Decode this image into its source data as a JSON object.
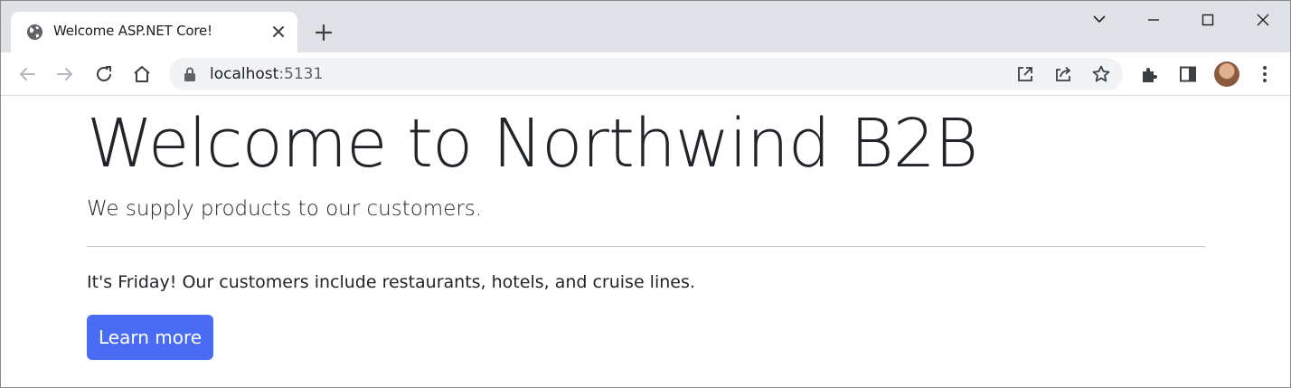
{
  "browser": {
    "tab": {
      "title": "Welcome ASP.NET Core!"
    },
    "address": {
      "host": "localhost",
      "port": ":5131"
    }
  },
  "page": {
    "heading": "Welcome to Northwind B2B",
    "lead": "We supply products to our customers.",
    "paragraph": "It's Friday! Our customers include restaurants, hotels, and cruise lines.",
    "button_label": "Learn more"
  },
  "colors": {
    "tabstrip": "#dee1e6",
    "primary_button": "#4a6cf5",
    "text": "#212529"
  },
  "icons": [
    "globe-icon",
    "close-icon",
    "plus-icon",
    "chevron-down-icon",
    "minimize-icon",
    "maximize-icon",
    "window-close-icon",
    "back-arrow-icon",
    "forward-arrow-icon",
    "reload-icon",
    "home-icon",
    "lock-icon",
    "open-in-icon",
    "share-icon",
    "star-icon",
    "puzzle-icon",
    "side-panel-icon",
    "kebab-menu-icon"
  ]
}
